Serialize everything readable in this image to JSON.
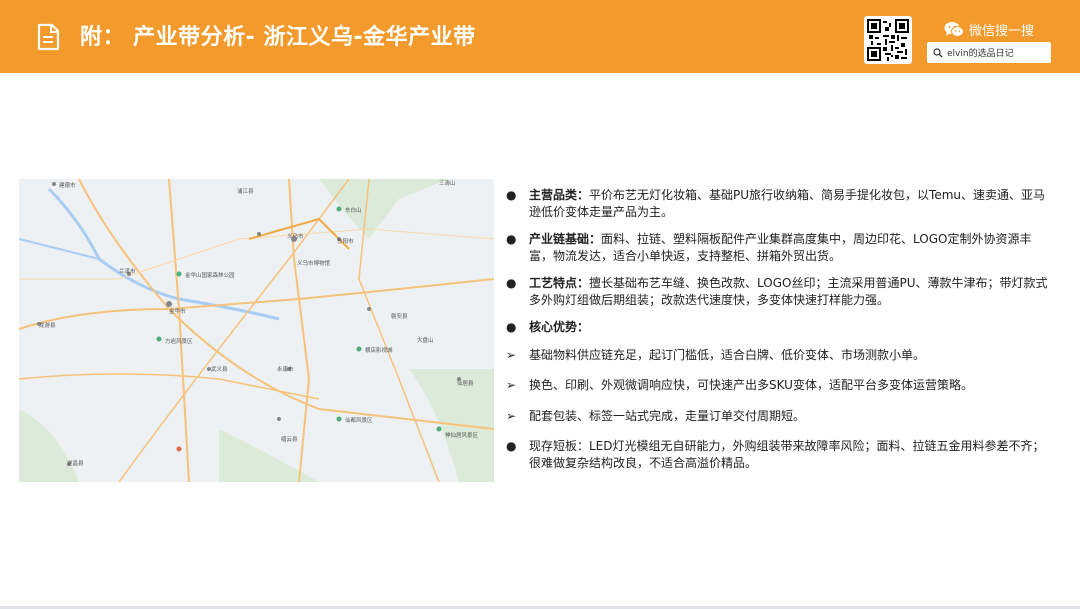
{
  "header": {
    "title": "附： 产业带分析- 浙江义乌-金华产业带",
    "icons": {
      "doc": "document-icon",
      "qr": "qr-code-icon",
      "wechat": "wechat-icon",
      "search": "search-icon"
    },
    "wechat_label": "微信搜一搜",
    "search_text": "elvin的选品日记",
    "color": "#f39a2c"
  },
  "map": {
    "labels": [
      "建德市",
      "兰溪市",
      "金华市",
      "浦江县",
      "义乌市",
      "东阳市",
      "磐安县",
      "武义县",
      "永康市",
      "缙云县",
      "仙居县",
      "龙游县",
      "遂昌县",
      "三清山",
      "大盘山",
      "金华山国家森林公园",
      "义乌市博物馆",
      "东白山",
      "横店影视城",
      "仙都风景区",
      "神仙居风景区",
      "方岩风景区"
    ]
  },
  "content": {
    "items": [
      {
        "kind": "dot",
        "label": "主营品类：",
        "text": "平价布艺无灯化妆箱、基础PU旅行收纳箱、简易手提化妆包，以Temu、速卖通、亚马逊低价变体走量产品为主。"
      },
      {
        "kind": "dot",
        "label": "产业链基础：",
        "text": "面料、拉链、塑料隔板配件产业集群高度集中，周边印花、LOGO定制外协资源丰富，物流发达，适合小单快返，支持整柜、拼箱外贸出货。"
      },
      {
        "kind": "dot",
        "label": "工艺特点：",
        "text": "擅长基础布艺车缝、换色改款、LOGO丝印；主流采用普通PU、薄款牛津布；带灯款式多外购灯组做后期组装；改款迭代速度快，多变体快速打样能力强。"
      },
      {
        "kind": "dot",
        "label": "核心优势：",
        "text": ""
      },
      {
        "kind": "arrow",
        "label": "",
        "text": "基础物料供应链充足，起订门槛低，适合白牌、低价变体、市场测款小单。"
      },
      {
        "kind": "arrow",
        "label": "",
        "text": "换色、印刷、外观微调响应快，可快速产出多SKU变体，适配平台多变体运营策略。"
      },
      {
        "kind": "arrow",
        "label": "",
        "text": "配套包装、标签一站式完成，走量订单交付周期短。"
      },
      {
        "kind": "dot",
        "label": "",
        "text": "现存短板：LED灯光模组无自研能力，外购组装带来故障率风险；面料、拉链五金用料参差不齐；很难做复杂结构改良，不适合高溢价精品。"
      }
    ],
    "bullets": {
      "dot": "●",
      "arrow": "➢"
    }
  }
}
